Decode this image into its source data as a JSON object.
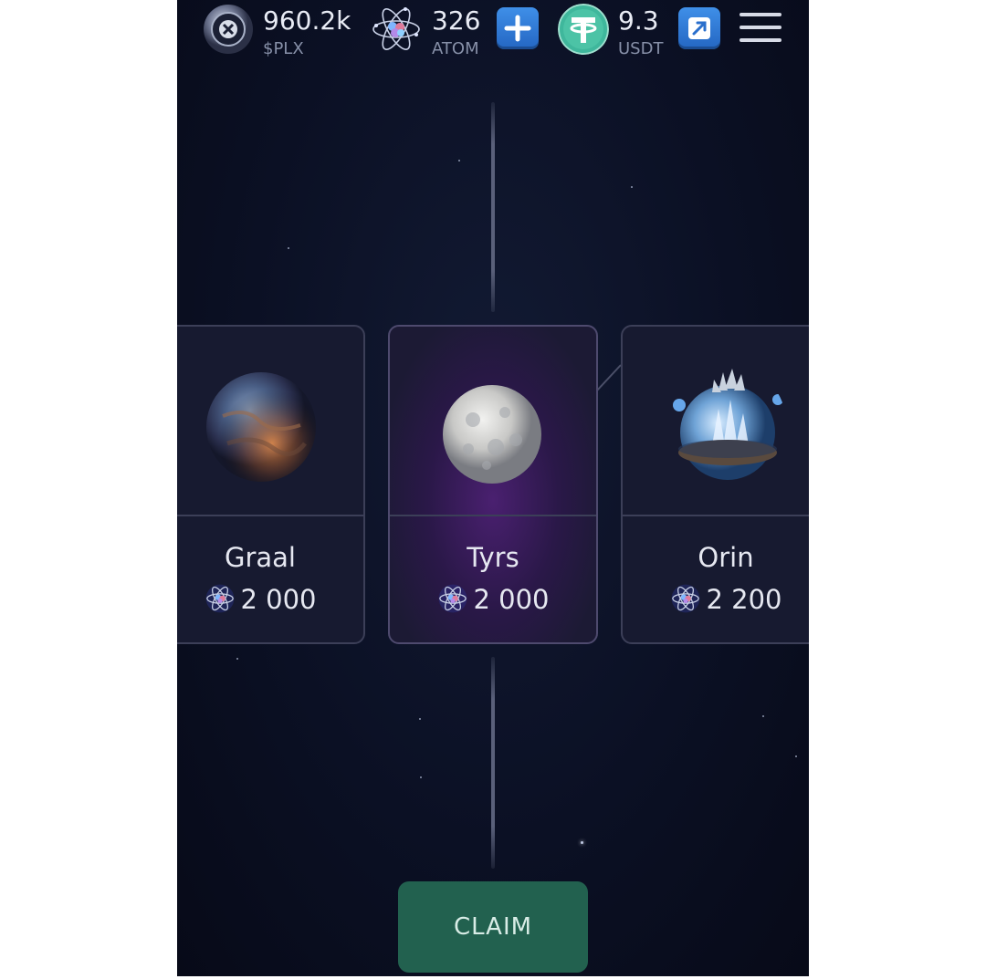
{
  "header": {
    "plx": {
      "amount": "960.2k",
      "unit": "$PLX",
      "icon": "plx-coin-icon"
    },
    "atom": {
      "amount": "326",
      "unit": "ATOM",
      "icon": "atom-icon",
      "add_icon": "plus-icon"
    },
    "usdt": {
      "amount": "9.3",
      "unit": "USDT",
      "icon": "tether-icon",
      "action_icon": "external-link-icon"
    },
    "menu_icon": "hamburger-menu-icon"
  },
  "cards": [
    {
      "name": "Graal",
      "price": "2 000",
      "currency_icon": "atom-icon"
    },
    {
      "name": "Tyrs",
      "price": "2 000",
      "currency_icon": "atom-icon",
      "selected": true
    },
    {
      "name": "Orin",
      "price": "2 200",
      "currency_icon": "atom-icon"
    }
  ],
  "claim": {
    "label": "CLAIM"
  },
  "colors": {
    "background": "#0b1024",
    "claim_button": "#22614f",
    "accent_blue": "#2f7ad6",
    "tether_green": "#3fb79c",
    "selected_glow": "#4a2070"
  }
}
